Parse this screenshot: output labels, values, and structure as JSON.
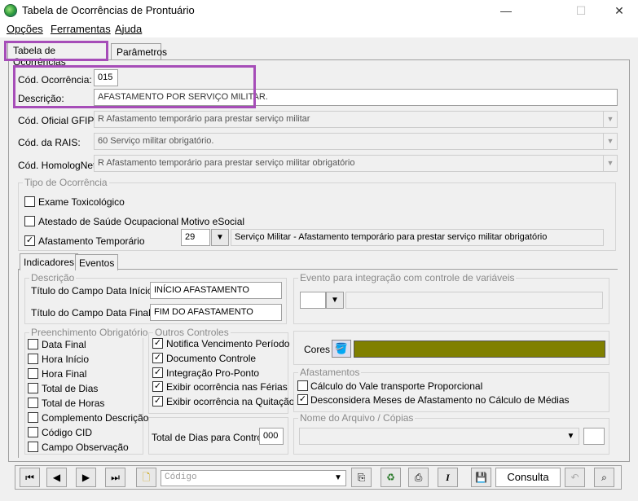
{
  "window": {
    "title": "Tabela de Ocorrências de Prontuário",
    "icon": "app-globe-icon",
    "controls": {
      "minimize": "—",
      "maximize": "☐",
      "close": "✕"
    }
  },
  "menu": {
    "items": [
      "Opções",
      "Ferramentas",
      "Ajuda"
    ]
  },
  "tabs": {
    "active": "Tabela de Ocorrências",
    "other": "Parâmetros"
  },
  "form": {
    "cod_ocorrencia_label": "Cód. Ocorrência:",
    "cod_ocorrencia_value": "015",
    "descricao_label": "Descrição:",
    "descricao_value": "AFASTAMENTO POR SERVIÇO MILITAR.",
    "gfip_label": "Cód. Oficial GFIP:",
    "gfip_value": "R  Afastamento temporário para prestar serviço militar",
    "rais_label": "Cód. da RAIS:",
    "rais_value": "60 Serviço militar obrigatório.",
    "homolog_label": "Cód. HomologNet:",
    "homolog_value": "R  Afastamento temporário para prestar serviço militar obrigatório"
  },
  "tipo": {
    "title": "Tipo de Ocorrência",
    "exame": {
      "label": "Exame Toxicológico",
      "checked": false
    },
    "atestado": {
      "label": "Atestado de Saúde Ocupacional",
      "checked": false
    },
    "afastamento": {
      "label": "Afastamento Temporário",
      "checked": true
    },
    "motivo_label": "Motivo eSocial",
    "motivo_code": "29",
    "motivo_desc": "Serviço Militar - Afastamento temporário para prestar serviço militar obrigatório"
  },
  "subtabs": {
    "active": "Indicadores",
    "other": "Eventos"
  },
  "descricao_group": {
    "title": "Descrição",
    "inicio_label": "Título do Campo Data Início:",
    "inicio_value": "INÍCIO AFASTAMENTO",
    "final_label": "Título do Campo Data Final:",
    "final_value": "FIM DO AFASTAMENTO"
  },
  "evento_group": {
    "title": "Evento para integração com controle de variáveis"
  },
  "preenchimento": {
    "title": "Preenchimento Obrigatório",
    "items": [
      {
        "label": "Data Final",
        "checked": false
      },
      {
        "label": "Hora Início",
        "checked": false
      },
      {
        "label": "Hora Final",
        "checked": false
      },
      {
        "label": "Total de Dias",
        "checked": false
      },
      {
        "label": "Total de Horas",
        "checked": false
      },
      {
        "label": "Complemento Descrição",
        "checked": false
      },
      {
        "label": "Código CID",
        "checked": false
      },
      {
        "label": "Campo Observação",
        "checked": false
      }
    ]
  },
  "outros": {
    "title": "Outros Controles",
    "items": [
      {
        "label": "Notifica Vencimento Período",
        "checked": true
      },
      {
        "label": "Documento Controle",
        "checked": true
      },
      {
        "label": "Integração Pro-Ponto",
        "checked": true
      },
      {
        "label": "Exibir ocorrência nas Férias",
        "checked": true
      },
      {
        "label": "Exibir ocorrência na Quitação",
        "checked": true
      }
    ],
    "total_label": "Total de Dias para Controle:",
    "total_value": "000"
  },
  "cores": {
    "label": "Cores",
    "color": "#808000"
  },
  "afastamentos": {
    "title": "Afastamentos",
    "items": [
      {
        "label": "Cálculo do Vale transporte Proporcional",
        "checked": false
      },
      {
        "label": "Desconsidera Meses de Afastamento no Cálculo de Médias",
        "checked": true
      }
    ]
  },
  "arquivo": {
    "title": "Nome do Arquivo / Cópias"
  },
  "toolbar": {
    "first": "⏮",
    "prev": "◀",
    "next": "▶",
    "last": "⏭",
    "codigo_placeholder": "Código",
    "consulta": "Consulta"
  },
  "colors": {
    "highlight": "#a64db8",
    "swatch": "#808000"
  }
}
